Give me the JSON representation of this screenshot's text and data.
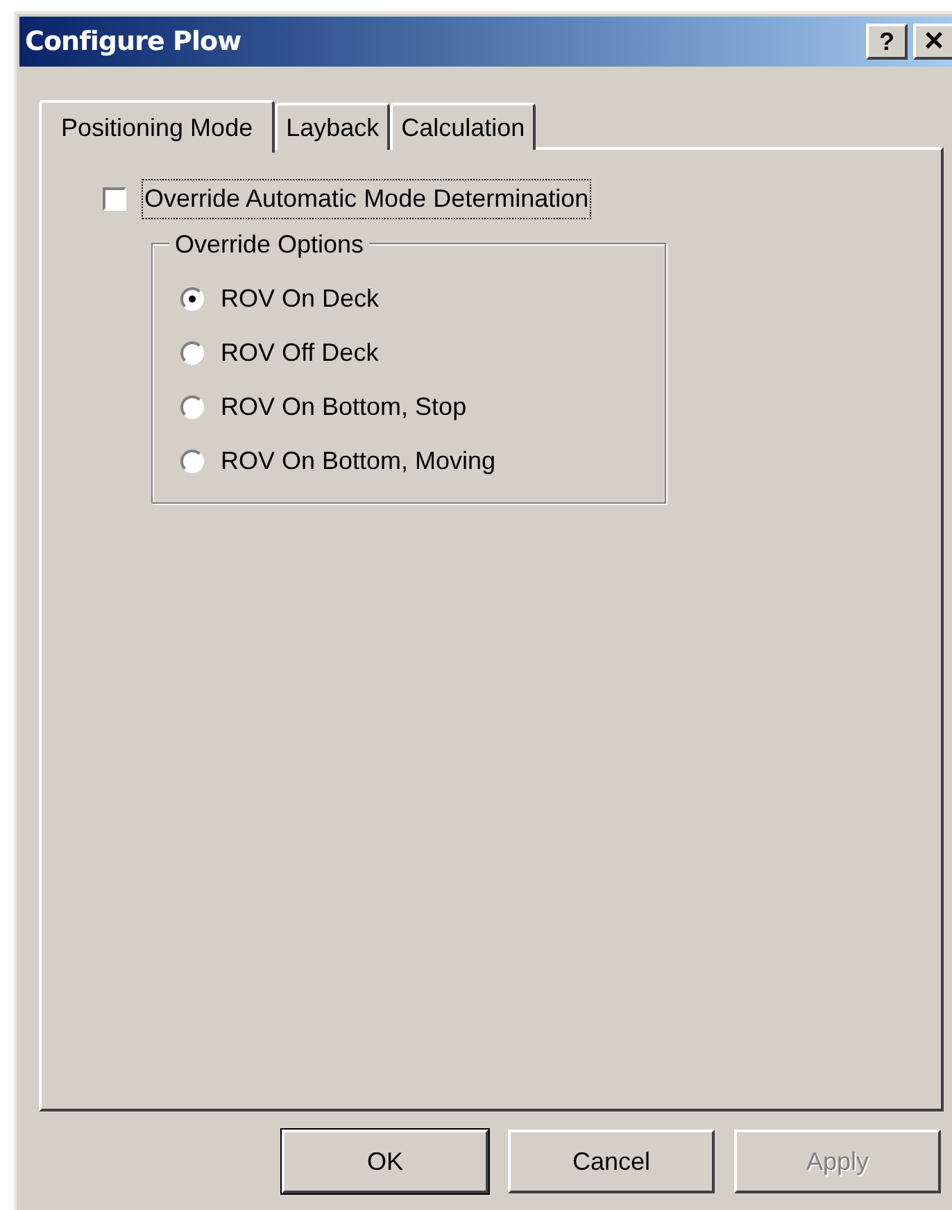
{
  "window": {
    "title": "Configure Plow",
    "title_buttons": [
      {
        "kind": "help",
        "label": "?"
      },
      {
        "kind": "close",
        "label": "×"
      }
    ]
  },
  "tabs": [
    {
      "label": "Positioning Mode",
      "selected": true
    },
    {
      "label": "Layback",
      "selected": false
    },
    {
      "label": "Calculation",
      "selected": false
    }
  ],
  "override_checkbox": {
    "label": "Override Automatic Mode Determination",
    "checked": false,
    "focused": true
  },
  "group": {
    "title": "Override Options",
    "options": [
      {
        "label": "ROV On Deck",
        "selected": true
      },
      {
        "label": "ROV Off Deck",
        "selected": false
      },
      {
        "label": "ROV On Bottom, Stop",
        "selected": false
      },
      {
        "label": "ROV On Bottom, Moving",
        "selected": false
      }
    ]
  },
  "buttons": [
    {
      "label": "OK",
      "default": true,
      "disabled": false
    },
    {
      "label": "Cancel",
      "default": false,
      "disabled": false
    },
    {
      "label": "Apply",
      "default": false,
      "disabled": true
    }
  ]
}
